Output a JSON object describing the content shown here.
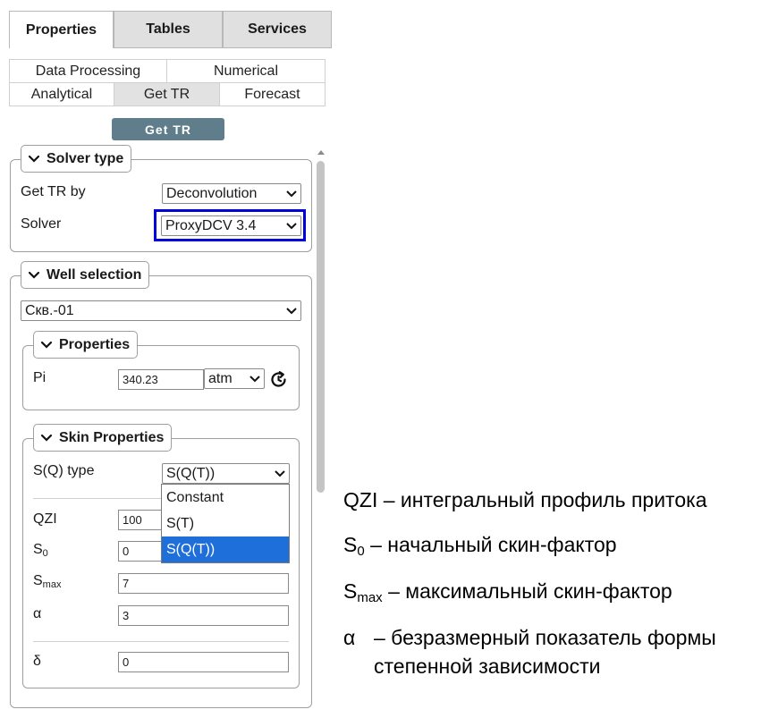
{
  "tabs": [
    {
      "label": "Properties",
      "active": true
    },
    {
      "label": "Tables",
      "active": false
    },
    {
      "label": "Services",
      "active": false
    }
  ],
  "subtabs": {
    "row1": [
      "Data Processing",
      "Numerical"
    ],
    "row2": [
      "Analytical",
      "Get TR",
      "Forecast"
    ],
    "selected": "Get TR"
  },
  "action_button": "Get TR",
  "solver": {
    "legend": "Solver type",
    "get_tr_by_label": "Get TR by",
    "get_tr_by_value": "Deconvolution",
    "solver_label": "Solver",
    "solver_value": "ProxyDCV 3.4",
    "highlight_color": "#0000d8"
  },
  "well": {
    "legend": "Well selection",
    "value": "Скв.-01",
    "properties": {
      "legend": "Properties",
      "pi_label": "Pi",
      "pi_value": "340.23",
      "unit": "atm"
    },
    "skin": {
      "legend": "Skin Properties",
      "sq_type_label": "S(Q) type",
      "sq_type_value": "S(Q(T))",
      "options": [
        "Constant",
        "S(T)",
        "S(Q(T))"
      ],
      "selected_option": "S(Q(T))",
      "qzi_label": "QZI",
      "qzi_value": "100",
      "s0_label": "S",
      "s0_sub": "0",
      "s0_value": "0",
      "smax_label": "S",
      "smax_sub": "max",
      "smax_value": "7",
      "alpha_label": "α",
      "alpha_value": "3",
      "delta_label": "δ",
      "delta_value": "0"
    }
  },
  "annotations": {
    "qzi": "QZI – интегральный профиль притока",
    "s0_sym": "S",
    "s0_sub": "0",
    "s0_text": " – начальный скин-фактор",
    "smax_sym": "S",
    "smax_sub": "max",
    "smax_text": " – максимальный скин-фактор",
    "alpha_sym": "α",
    "alpha_text": "– безразмерный показатель формы",
    "alpha_text2": "степенной зависимости"
  },
  "icons": {
    "chevron": "chevron-down-icon",
    "refresh": "refresh-icon",
    "dropdown": "dropdown-arrow-icon"
  },
  "colors": {
    "button_bg": "#607d8b",
    "option_selected": "#1e6fd9",
    "tab_inactive": "#e0e0e0"
  }
}
